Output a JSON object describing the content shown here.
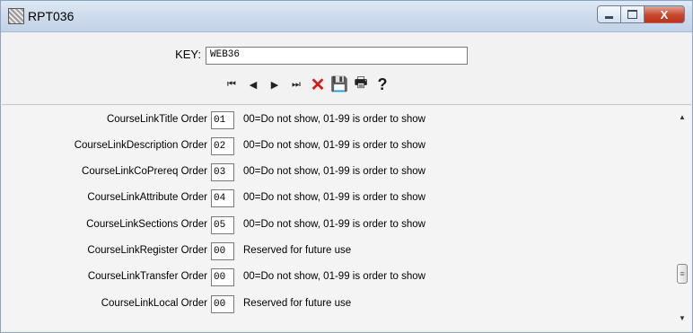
{
  "window": {
    "title": "RPT036",
    "buttons": {
      "minimize": "–",
      "maximize": "▢",
      "close": "X"
    }
  },
  "header": {
    "key_label": "KEY:",
    "key_value": "WEB36"
  },
  "toolbar": {
    "first_icon": "⏮",
    "prev_icon": "◀",
    "next_icon": "▶",
    "last_icon": "⏭",
    "delete_icon": "✕",
    "save_icon": "💾",
    "print_icon": "🖶",
    "help_icon": "?"
  },
  "rows": [
    {
      "label": "CourseLinkTitle Order",
      "value": "01",
      "desc": "00=Do not show, 01-99 is order to show"
    },
    {
      "label": "CourseLinkDescription Order",
      "value": "02",
      "desc": "00=Do not show, 01-99 is order to show"
    },
    {
      "label": "CourseLinkCoPrereq Order",
      "value": "03",
      "desc": "00=Do not show, 01-99 is order to show"
    },
    {
      "label": "CourseLinkAttribute Order",
      "value": "04",
      "desc": "00=Do not show, 01-99 is order to show"
    },
    {
      "label": "CourseLinkSections Order",
      "value": "05",
      "desc": "00=Do not show, 01-99 is order to show"
    },
    {
      "label": "CourseLinkRegister Order",
      "value": "00",
      "desc": "Reserved for future use"
    },
    {
      "label": "CourseLinkTransfer Order",
      "value": "00",
      "desc": "00=Do not show, 01-99 is order to show"
    },
    {
      "label": "CourseLinkLocal Order",
      "value": "00",
      "desc": "Reserved for future use"
    }
  ],
  "scrollbar": {
    "up_arrow": "▲",
    "down_arrow": "▼",
    "grip": "≡"
  }
}
